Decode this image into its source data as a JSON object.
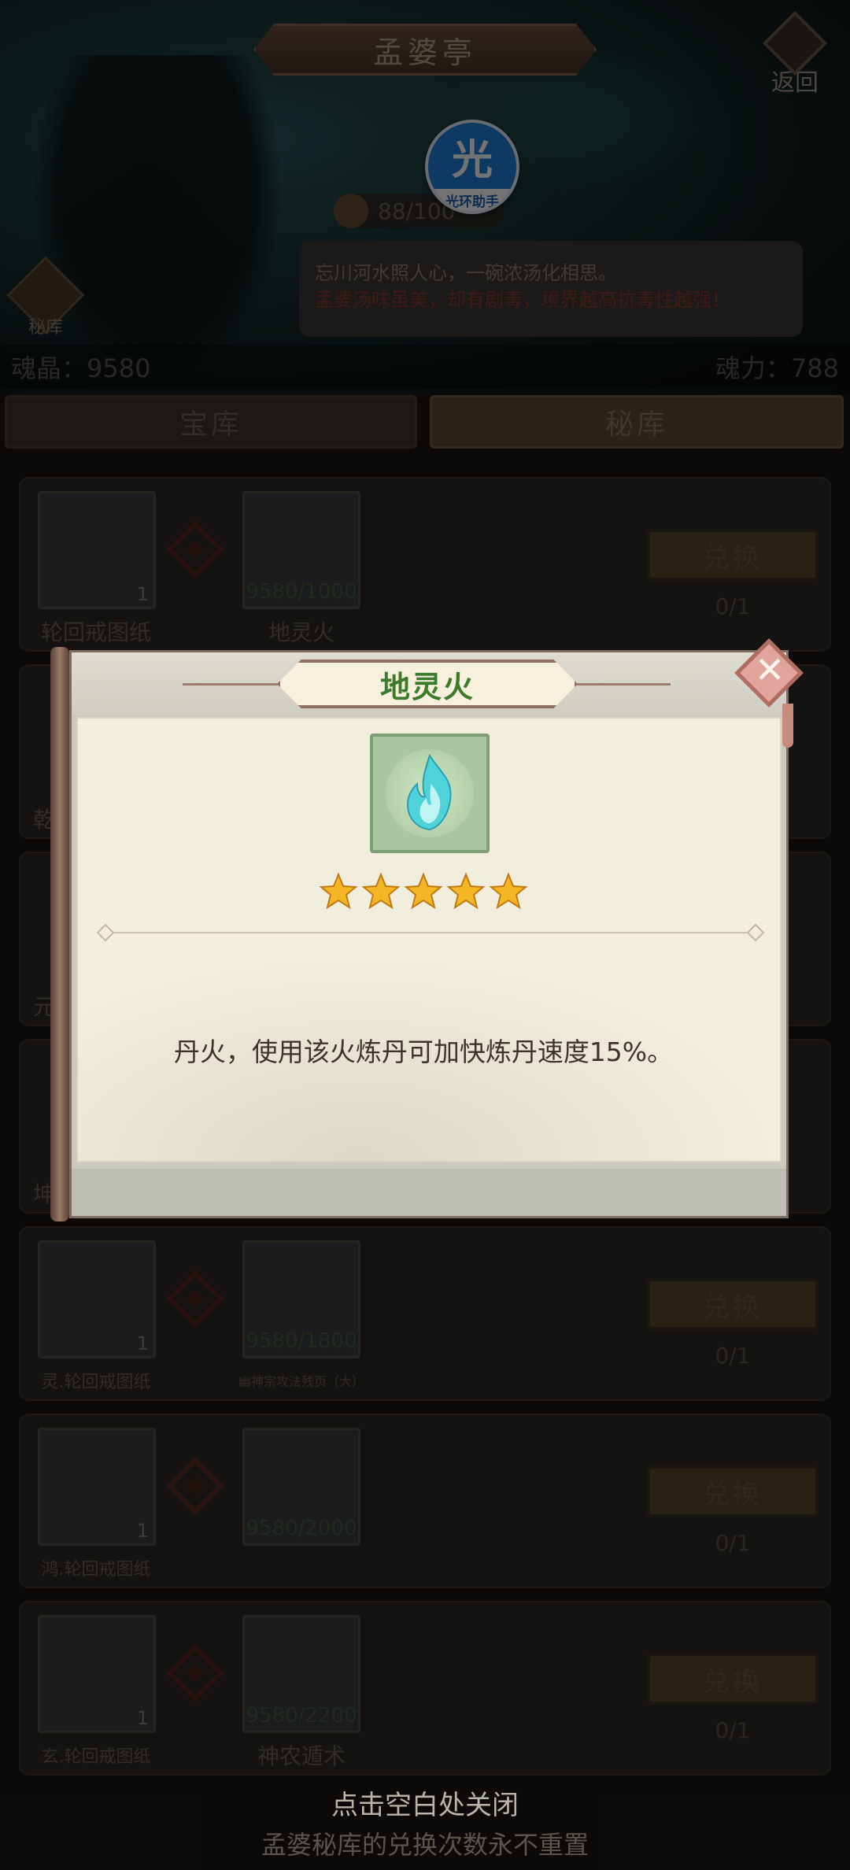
{
  "header": {
    "title": "孟婆亭",
    "back_label": "返回"
  },
  "helper_badge": {
    "glyph": "光",
    "label": "光环助手"
  },
  "stamina": {
    "value": "88/100"
  },
  "dialog": {
    "line1": "忘川河水照人心，一碗浓汤化相思。",
    "line2": "孟婆汤味虽美，却有剧毒，境界越高抗毒性越强！"
  },
  "secret_icon": {
    "label": "秘库"
  },
  "currency": {
    "soul_crystal": "魂晶：9580",
    "soul_power": "魂力：788"
  },
  "tabs": [
    {
      "label": "宝库"
    },
    {
      "label": "秘库"
    }
  ],
  "exchange_rows": [
    {
      "give_name": "轮回戒图纸",
      "give_count": "1",
      "get_name": "地灵火",
      "get_req": "9580/1000",
      "button": "兑换",
      "limit": "0/1"
    },
    {
      "give_name": "灵.轮回戒图纸",
      "give_count": "1",
      "get_name": "幽神宗攻法残页（大）",
      "get_req": "9580/1800",
      "button": "兑换",
      "limit": "0/1"
    },
    {
      "give_name": "鸿.轮回戒图纸",
      "give_count": "1",
      "get_name": "",
      "get_req": "9580/2000",
      "button": "兑换",
      "limit": "0/1"
    },
    {
      "give_name": "玄.轮回戒图纸",
      "give_count": "1",
      "get_name": "神农遁术",
      "get_req": "9580/2200",
      "button": "兑换",
      "limit": "0/1"
    }
  ],
  "hidden_row_labels": [
    "乾",
    "元",
    "坤"
  ],
  "popup": {
    "title": "地灵火",
    "stars": 5,
    "description": "丹火，使用该火炼丹可加快炼丹速度15%。",
    "icon": "blue-flame-icon"
  },
  "bottom": {
    "hint": "点击空白处关闭",
    "note": "孟婆秘库的兑换次数永不重置"
  },
  "colors": {
    "popup_title": "#3c7a2c",
    "star": "#f5b626",
    "flame": "#4fd2d8"
  }
}
